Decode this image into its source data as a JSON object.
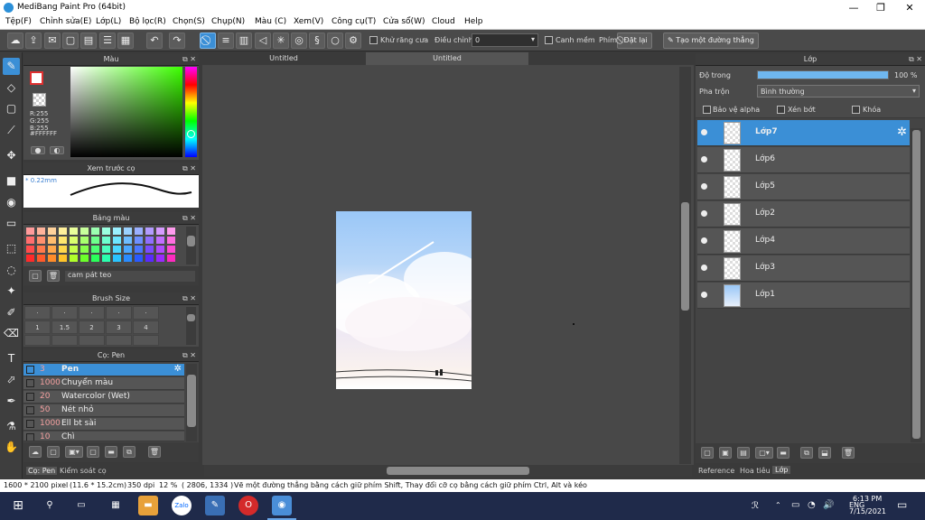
{
  "window": {
    "title": "MediBang Paint Pro (64bit)",
    "min": "—",
    "max": "❐",
    "close": "✕"
  },
  "menu": [
    "Tệp(F)",
    "Chỉnh sửa(E)",
    "Lớp(L)",
    "Bộ lọc(R)",
    "Chọn(S)",
    "Chụp(N)",
    "Màu (C)",
    "Xem(V)",
    "Công cụ(T)",
    "Cửa sổ(W)",
    "Cloud",
    "Help"
  ],
  "toolbar": {
    "antialias_label": "Khử răng cưa",
    "correction_label": "Điều chỉnh",
    "correction_value": "0",
    "snap_label": "Canh mềm",
    "key_label": "Phím",
    "reset_label": "Đặt lại",
    "line_label": "Tạo một đường thẳng"
  },
  "color_panel": {
    "title": "Màu",
    "r": "R:255",
    "g": "G:255",
    "b": "B:255",
    "hex": "#FFFFFF",
    "primary": "#ffffff",
    "secondary": "#ffffff"
  },
  "brush_preview": {
    "title": "Xem trước cọ",
    "size": "* 0.22mm"
  },
  "palette": {
    "title": "Bảng màu",
    "name": "cam pát teo",
    "colors": [
      "#ff9b9b",
      "#ffb39b",
      "#ffd29b",
      "#fff09b",
      "#e9ff9b",
      "#c7ff9b",
      "#9bffb0",
      "#9bffe0",
      "#9bf0ff",
      "#9bd2ff",
      "#9bb0ff",
      "#b39bff",
      "#d69bff",
      "#ff9bee",
      "#ff6e6e",
      "#ff906e",
      "#ffbd6e",
      "#ffe66e",
      "#dbff6e",
      "#a8ff6e",
      "#6eff8c",
      "#6effd0",
      "#6ee6ff",
      "#6ebdff",
      "#6e90ff",
      "#906eff",
      "#c36eff",
      "#ff6ee0",
      "#ff4c4c",
      "#ff7a4c",
      "#ffa84c",
      "#ffd84c",
      "#c7ff4c",
      "#88ff4c",
      "#4cff74",
      "#4cffc0",
      "#4cd8ff",
      "#4ca8ff",
      "#4c78ff",
      "#7a4cff",
      "#b04cff",
      "#ff4cd4",
      "#ff2a2a",
      "#ff5a2a",
      "#ff8c2a",
      "#ffc42a",
      "#b0ff2a",
      "#6cff2a",
      "#2aff5a",
      "#2affae",
      "#2ac4ff",
      "#2a8cff",
      "#2a5aff",
      "#5a2aff",
      "#9a2aff",
      "#ff2ac0"
    ]
  },
  "brush_size": {
    "title": "Brush Size",
    "row1": [
      "·",
      "·",
      "·",
      "·",
      "·",
      "·"
    ],
    "row2": [
      "1",
      "1.5",
      "2",
      "3",
      "4",
      ""
    ]
  },
  "brush_list": {
    "title": "Cọ: Pen",
    "items": [
      {
        "size": "3",
        "name": "Pen",
        "color": "#333333"
      },
      {
        "size": "1000",
        "name": "Chuyển màu",
        "color": "#cccccc"
      },
      {
        "size": "20",
        "name": "Watercolor (Wet)",
        "color": "#66ccff"
      },
      {
        "size": "50",
        "name": "Nét nhỏ",
        "color": "#222222"
      },
      {
        "size": "1000",
        "name": "Ell bt sài",
        "color": "#ff99cc"
      },
      {
        "size": "10",
        "name": "Chì",
        "color": "#333333"
      }
    ]
  },
  "bottom_tabs": {
    "brush": "Cọ: Pen",
    "material": "Kiểm soát cọ"
  },
  "doc_tabs": [
    "Untitled",
    "Untitled"
  ],
  "layer_panel": {
    "title": "Lớp",
    "opacity_label": "Độ trong",
    "opacity_value": "100 %",
    "opacity_fraction": 1.0,
    "blend_label": "Pha trộn",
    "blend_value": "Bình thường",
    "protect_alpha": "Bảo vệ alpha",
    "clipping": "Xén bớt",
    "lock": "Khóa",
    "layers": [
      "Lớp7",
      "Lớp6",
      "Lớp5",
      "Lớp2",
      "Lớp4",
      "Lớp3",
      "Lớp1"
    ],
    "tabs": [
      "Reference",
      "Hoa tiêu",
      "Lớp"
    ]
  },
  "status": {
    "size": "1600 * 2100 pixel",
    "cm": "(11.6 * 15.2cm)",
    "dpi": "350 dpi",
    "zoom": "12 %",
    "coords": "( 2806, 1334 )",
    "hint": "Vẽ một đường thẳng bằng cách giữ phím Shift, Thay đổi cỡ cọ bằng cách giữ phím Ctrl, Alt và kéo"
  },
  "taskbar": {
    "lang": "ENG",
    "time": "6:13 PM",
    "date": "7/15/2021",
    "zalo": "Zalo"
  }
}
